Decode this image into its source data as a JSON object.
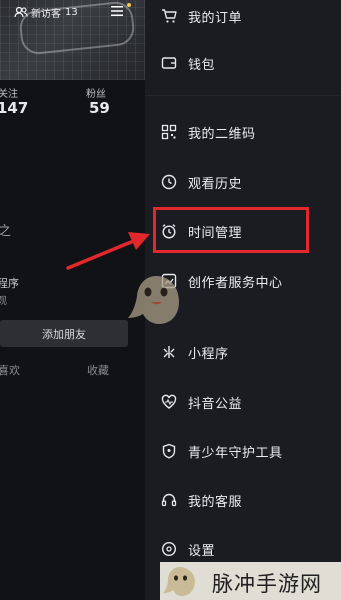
{
  "profile": {
    "visitor_label": "新访客",
    "visitor_count": "13",
    "follow_label": "关注",
    "follow_count": "147",
    "fans_label": "粉丝",
    "fans_count": "59",
    "side_symbol": "之",
    "mini_program_title": "程序",
    "mini_program_sub": "观",
    "add_friend_button": "添加朋友",
    "tab_like": "喜欢",
    "tab_favorite": "收藏"
  },
  "menu": {
    "items": [
      {
        "label": "我的订单",
        "icon": "cart-icon"
      },
      {
        "label": "钱包",
        "icon": "wallet-icon"
      },
      {
        "label": "我的二维码",
        "icon": "qr-code-icon"
      },
      {
        "label": "观看历史",
        "icon": "history-clock-icon"
      },
      {
        "label": "时间管理",
        "icon": "alarm-clock-icon"
      },
      {
        "label": "创作者服务中心",
        "icon": "creator-chart-icon"
      },
      {
        "label": "小程序",
        "icon": "mini-program-icon"
      },
      {
        "label": "抖音公益",
        "icon": "charity-heart-icon"
      },
      {
        "label": "青少年守护工具",
        "icon": "shield-icon"
      },
      {
        "label": "我的客服",
        "icon": "headset-icon"
      },
      {
        "label": "设置",
        "icon": "settings-icon"
      }
    ]
  },
  "annotation": {
    "highlight_color": "#e2282c",
    "highlighted_item": "时间管理"
  },
  "watermark": {
    "text": "脉冲手游网"
  }
}
